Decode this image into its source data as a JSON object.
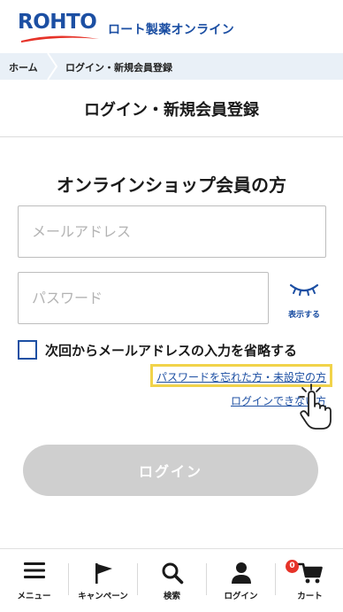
{
  "header": {
    "logo_text": "ROHTO",
    "site_name": "ロート製薬オンライン"
  },
  "breadcrumb": {
    "home": "ホーム",
    "current": "ログイン・新規会員登録"
  },
  "page_title": "ログイン・新規会員登録",
  "form": {
    "section_title": "オンラインショップ会員の方",
    "email_placeholder": "メールアドレス",
    "email_value": "",
    "password_placeholder": "パスワード",
    "password_value": "",
    "show_password_label": "表示する",
    "remember_label": "次回からメールアドレスの入力を省略する",
    "remember_checked": false,
    "forgot_link": "パスワードを忘れた方・未設定の方",
    "cannot_login_link": "ログインできない方",
    "login_button": "ログイン"
  },
  "tabbar": {
    "menu": "メニュー",
    "campaign": "キャンペーン",
    "search": "検索",
    "login": "ログイン",
    "cart": "カート",
    "cart_count": "0"
  },
  "colors": {
    "brand": "#1c4fa3",
    "highlight": "#f1d34a",
    "disabled_button": "#cfcfcf",
    "badge": "#e63329"
  }
}
